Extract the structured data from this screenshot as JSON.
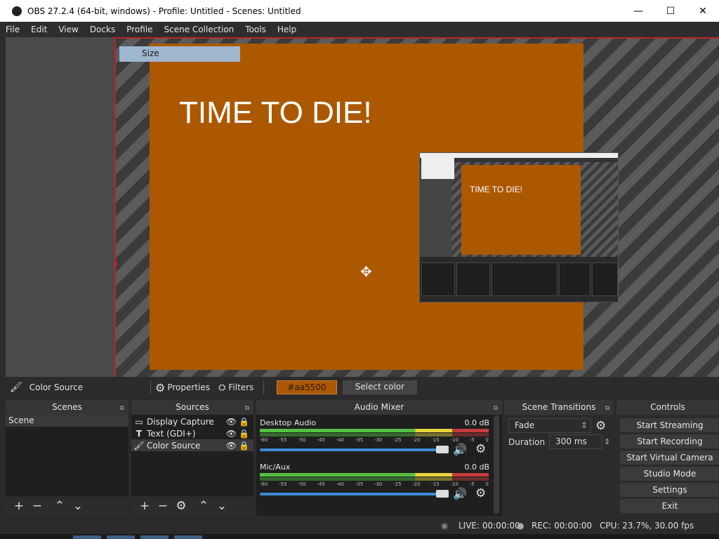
{
  "window": {
    "title": "OBS 27.2.4 (64-bit, windows) - Profile: Untitled - Scenes: Untitled",
    "min": "—",
    "max": "☐",
    "close": "✕"
  },
  "menu": [
    "File",
    "Edit",
    "View",
    "Docks",
    "Profile",
    "Scene Collection",
    "Tools",
    "Help"
  ],
  "preview": {
    "size_label": "Size",
    "canvas_text": "TIME TO DIE!",
    "nested_text": "TIME TO DIE!"
  },
  "toolbar": {
    "source_name": "Color Source",
    "properties": "Properties",
    "filters": "Filters",
    "color_value": "#aa5500",
    "select_color": "Select color"
  },
  "scenes": {
    "title": "Scenes",
    "items": [
      "Scene"
    ]
  },
  "sources": {
    "title": "Sources",
    "items": [
      {
        "name": "Display Capture",
        "icon": "monitor-icon"
      },
      {
        "name": "Text (GDI+)",
        "icon": "text-icon"
      },
      {
        "name": "Color Source",
        "icon": "brush-icon"
      }
    ]
  },
  "mixer": {
    "title": "Audio Mixer",
    "channels": [
      {
        "name": "Desktop Audio",
        "db": "0.0 dB"
      },
      {
        "name": "Mic/Aux",
        "db": "0.0 dB"
      }
    ],
    "scale": [
      "-60",
      "-55",
      "-50",
      "-45",
      "-40",
      "-35",
      "-30",
      "-25",
      "-20",
      "-15",
      "-10",
      "-5",
      "0"
    ]
  },
  "transitions": {
    "title": "Scene Transitions",
    "selected": "Fade",
    "duration_label": "Duration",
    "duration_value": "300 ms"
  },
  "controls": {
    "title": "Controls",
    "buttons": [
      "Start Streaming",
      "Start Recording",
      "Start Virtual Camera",
      "Studio Mode",
      "Settings",
      "Exit"
    ]
  },
  "status": {
    "live": "LIVE: 00:00:00",
    "rec": "REC: 00:00:00",
    "cpu": "CPU: 23.7%, 30.00 fps"
  },
  "colors": {
    "canvas": "#ac5800",
    "accent_blue": "#3e8bd6",
    "red_border": "#c0202a"
  }
}
